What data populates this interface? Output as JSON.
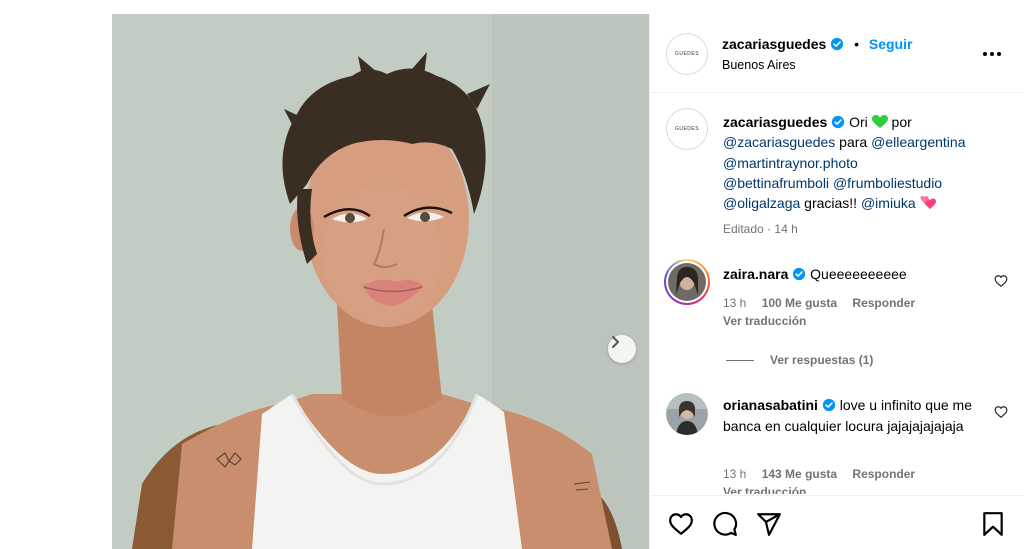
{
  "post": {
    "username": "zacariasguedes",
    "logo_text": "GUEDES",
    "follow_label": "Seguir",
    "separator": "•",
    "location": "Buenos Aires"
  },
  "caption": {
    "username": "zacariasguedes",
    "t1": "Ori",
    "t2": "por",
    "m1": "@zacariasguedes",
    "t3": "para",
    "m2": "@elleargentina",
    "m3": "@martintraynor.photo",
    "m4": "@bettinafrumboli",
    "m5": "@frumboliestudio",
    "m6": "@oligalzaga",
    "t4": "gracias!!",
    "m7": "@imiuka",
    "edited": "Editado",
    "dot": "·",
    "time": "14 h"
  },
  "comments": [
    {
      "username": "zaira.nara",
      "text": "Queeeeeeeeee",
      "time": "13 h",
      "likes": "100 Me gusta",
      "reply": "Responder",
      "translate": "Ver traducción",
      "view_replies": "Ver respuestas (1)"
    },
    {
      "username": "orianasabatini",
      "text": "love u infinito que me banca en cualquier locura jajajajajajaja",
      "time": "13 h",
      "likes": "143 Me gusta",
      "reply": "Responder",
      "translate": "Ver traducción"
    }
  ],
  "icons": {
    "verified": "verified-badge-icon",
    "green_heart": "green-heart-emoji",
    "two_hearts": "two-hearts-emoji",
    "more": "more-options-icon",
    "next": "chevron-right-icon",
    "like": "heart-icon",
    "comment": "comment-icon",
    "share": "paper-plane-icon",
    "save": "bookmark-icon"
  },
  "colors": {
    "link": "#0095f6",
    "mention": "#00376b",
    "verified": "#0095f6",
    "muted": "#737373"
  }
}
